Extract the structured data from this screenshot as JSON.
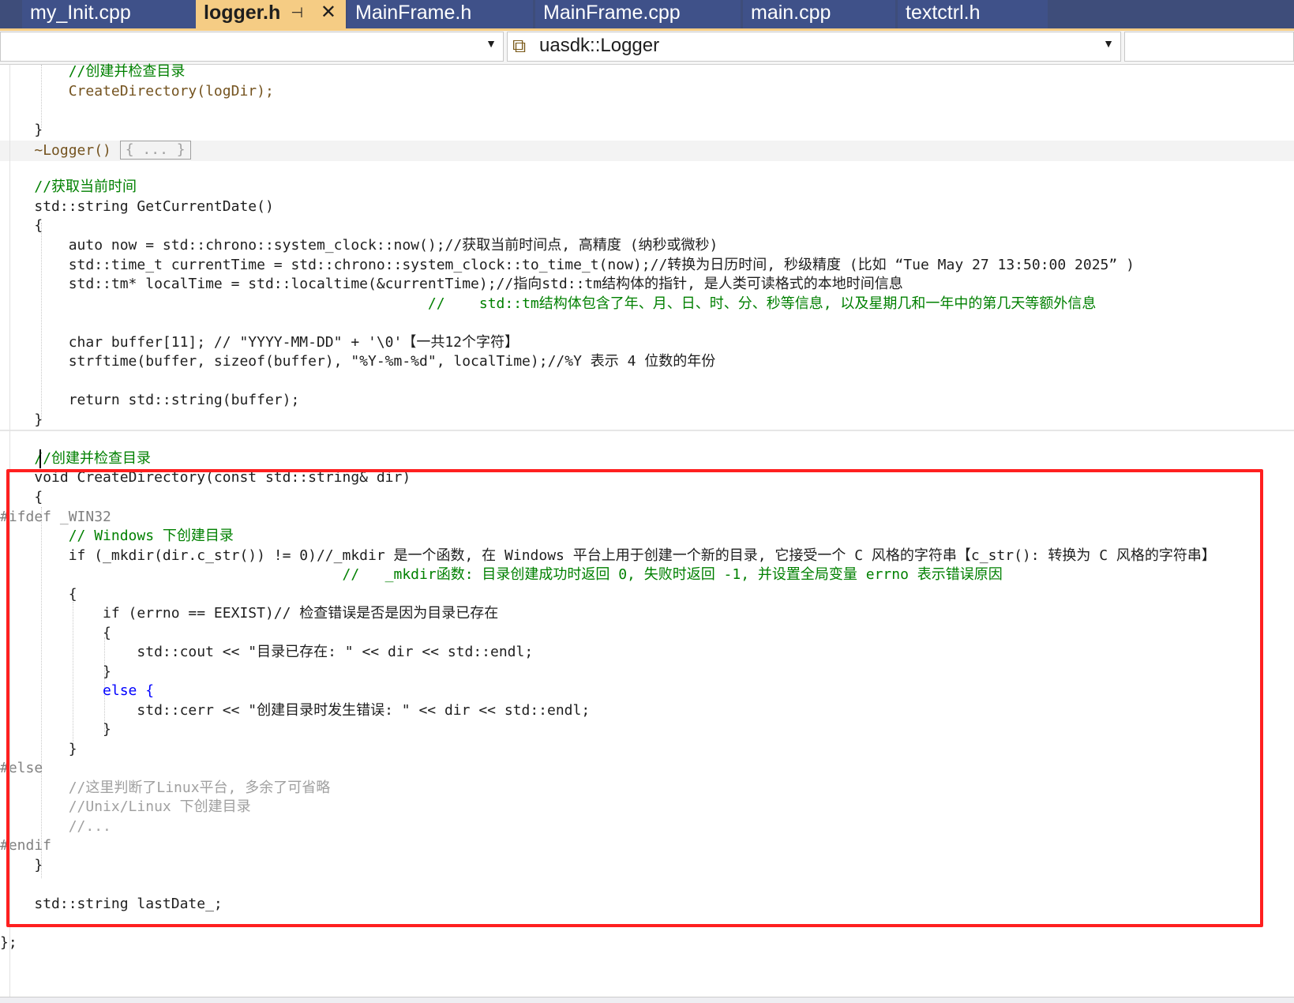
{
  "tabs": [
    {
      "label": "my_Init.cpp"
    },
    {
      "label": "logger.h",
      "pin": "⊣",
      "close": "✕"
    },
    {
      "label": "MainFrame.h"
    },
    {
      "label": "MainFrame.cpp"
    },
    {
      "label": "main.cpp"
    },
    {
      "label": "textctrl.h"
    }
  ],
  "nav": {
    "scope": "",
    "member": "uasdk::Logger",
    "member_icon": "class-icon"
  },
  "code": {
    "l01": "//创建并检查目录",
    "l02": "CreateDirectory(logDir);",
    "l03": "}",
    "l04": "~Logger()",
    "l04_fold": "{ ... }",
    "l05": "//获取当前时间",
    "l06": "std::string GetCurrentDate()",
    "l07": "{",
    "l08": "auto now = std::chrono::system_clock::now();//获取当前时间点, 高精度 (纳秒或微秒)",
    "l09": "std::time_t currentTime = std::chrono::system_clock::to_time_t(now);//转换为日历时间, 秒级精度 (比如 “Tue May 27 13:50:00 2025” )",
    "l10": "std::tm* localTime = std::localtime(&currentTime);//指向std::tm结构体的指针, 是人类可读格式的本地时间信息",
    "l11": "//    std::tm结构体包含了年、月、日、时、分、秒等信息, 以及星期几和一年中的第几天等额外信息",
    "l12": "char buffer[11]; // \"YYYY-MM-DD\" + '\\0'【一共12个字符】",
    "l13": "strftime(buffer, sizeof(buffer), \"%Y-%m-%d\", localTime);//%Y 表示 4 位数的年份",
    "l14": "return std::string(buffer);",
    "l15": "}",
    "l16": "//创建并检查目录",
    "l17": "void CreateDirectory(const std::string& dir)",
    "l18": "{",
    "l19": "#ifdef _WIN32",
    "l20": "// Windows 下创建目录",
    "l21": "if (_mkdir(dir.c_str()) != 0)//_mkdir 是一个函数, 在 Windows 平台上用于创建一个新的目录, 它接受一个 C 风格的字符串【c_str(): 转换为 C 风格的字符串】",
    "l22": "//   _mkdir函数: 目录创建成功时返回 0, 失败时返回 -1, 并设置全局变量 errno 表示错误原因",
    "l23": "{",
    "l24": "if (errno == EEXIST)// 检查错误是否是因为目录已存在",
    "l25": "{",
    "l26": "std::cout << \"目录已存在: \" << dir << std::endl;",
    "l27": "}",
    "l28": "else {",
    "l29": "std::cerr << \"创建目录时发生错误: \" << dir << std::endl;",
    "l30": "}",
    "l31": "}",
    "l32": "#else",
    "l33": "//这里判断了Linux平台, 多余了可省略",
    "l34": "//Unix/Linux 下创建目录",
    "l35": "//...",
    "l36": "#endif",
    "l37": "}",
    "l38": "std::string lastDate_;",
    "l39": "};"
  },
  "colors": {
    "tab_bg": "#3f5189",
    "tab_active": "#f5cc84",
    "comment": "#008000",
    "keyword": "#0000ff",
    "type": "#2b91af",
    "string": "#a31515",
    "highlight_box": "#ff1f1f"
  }
}
